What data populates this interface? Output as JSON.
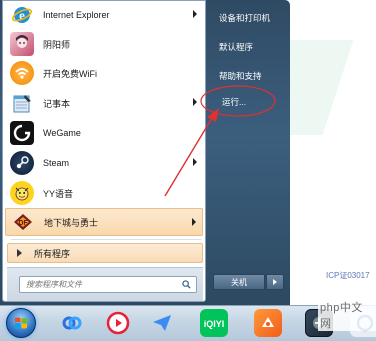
{
  "start_menu": {
    "programs": [
      {
        "label": "Internet Explorer",
        "icon": "internet-explorer-icon",
        "has_submenu": true
      },
      {
        "label": "阴阳师",
        "icon": "onmyoji-icon",
        "has_submenu": false
      },
      {
        "label": "开启免费WiFi",
        "icon": "wifi-icon",
        "has_submenu": false
      },
      {
        "label": "记事本",
        "icon": "notepad-icon",
        "has_submenu": true
      },
      {
        "label": "WeGame",
        "icon": "wegame-icon",
        "has_submenu": false
      },
      {
        "label": "Steam",
        "icon": "steam-icon",
        "has_submenu": true
      },
      {
        "label": "YY语音",
        "icon": "yy-voice-icon",
        "has_submenu": false
      },
      {
        "label": "地下城与勇士",
        "icon": "dnf-icon",
        "has_submenu": true,
        "highlighted": true
      }
    ],
    "all_programs_label": "所有程序",
    "search_placeholder": "搜索程序和文件",
    "right_items": [
      {
        "label": "设备和打印机"
      },
      {
        "label": "默认程序"
      },
      {
        "label": "帮助和支持"
      },
      {
        "label": "运行..."
      }
    ],
    "shutdown_label": "关机"
  },
  "background": {
    "text": "ICP证03017",
    "watermark": "php中文网"
  },
  "taskbar": {
    "icons": [
      "start-orb-icon",
      "baidu-netdisk-icon",
      "video-player-icon",
      "feishu-icon",
      "iqiyi-icon",
      "game-assistant-icon",
      "app-icon",
      "partial-app-icon"
    ]
  },
  "colors": {
    "start_menu_frame": "#3c5f7f",
    "highlight": "#f9d8ab",
    "annotation": "#e03030"
  }
}
